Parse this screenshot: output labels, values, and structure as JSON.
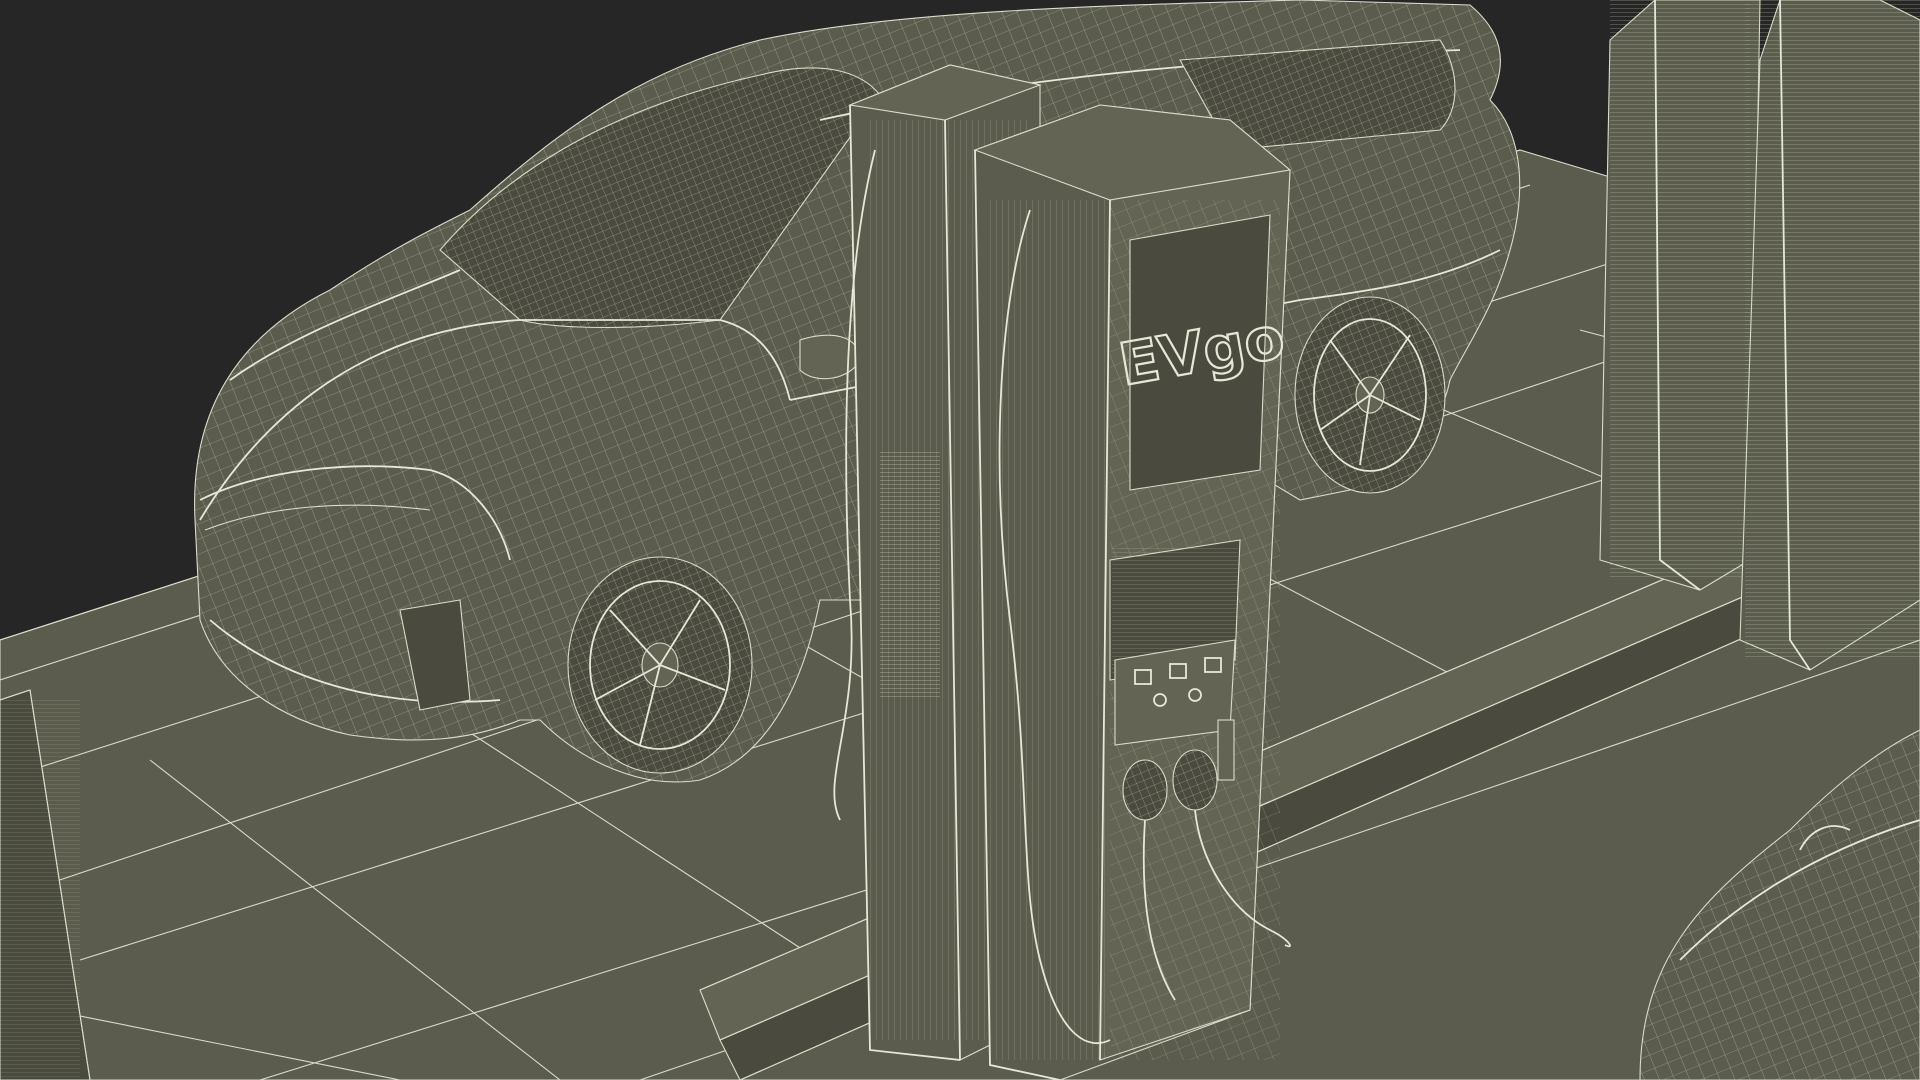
{
  "scene": {
    "background_color": "#262626",
    "surface_color": "#5b5c4d",
    "wire_color": "#d9dcc8"
  },
  "charger": {
    "logo_text": "EVgo"
  }
}
